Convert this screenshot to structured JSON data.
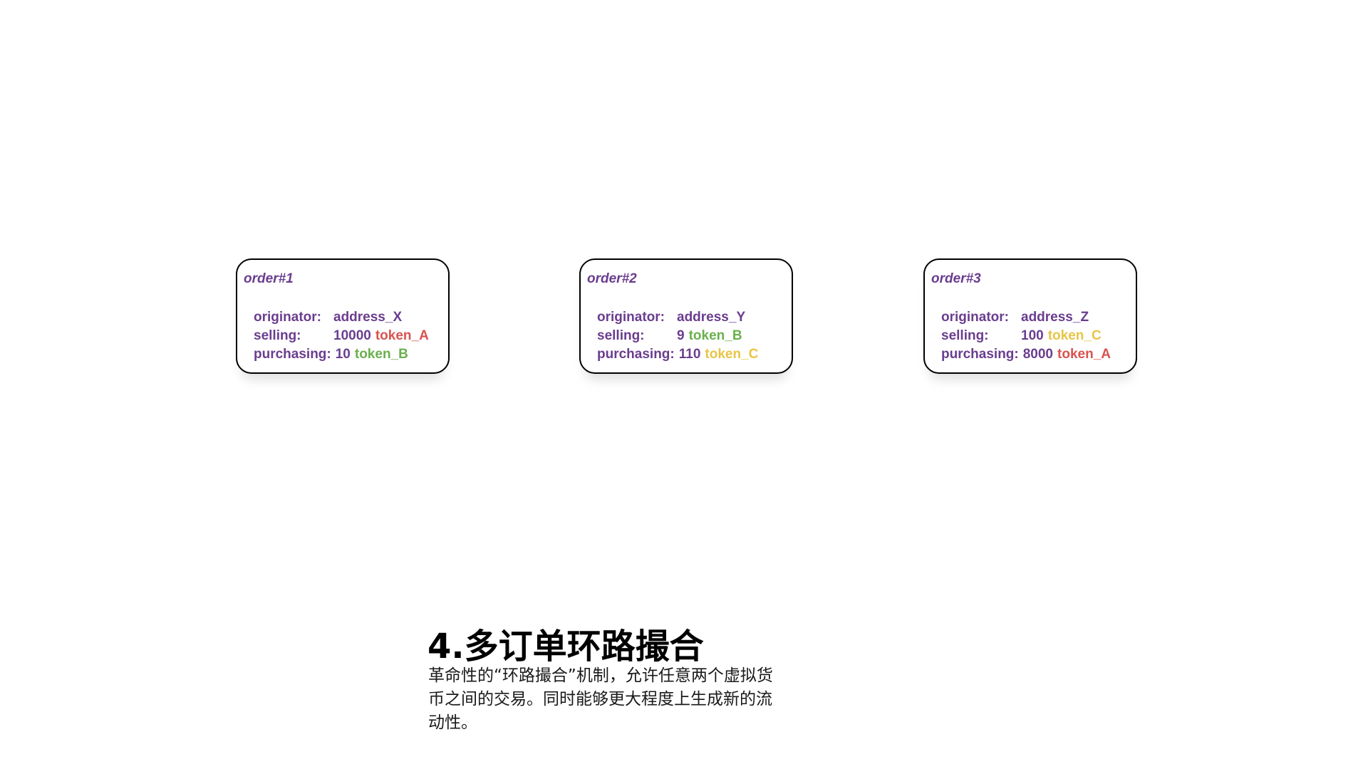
{
  "colors": {
    "text_purple": "#6a3d8f",
    "token_A": "#d9534f",
    "token_B": "#6ab04c",
    "token_C": "#e8c547",
    "card_border": "#000000"
  },
  "orders": [
    {
      "title": "order#1",
      "originator_label": "originator:",
      "originator_value": "address_X",
      "selling_label": "selling:",
      "selling_amount": "10000",
      "selling_token": "token_A",
      "purchasing_label": "purchasing:",
      "purchasing_amount": "10",
      "purchasing_token": "token_B"
    },
    {
      "title": "order#2",
      "originator_label": "originator:",
      "originator_value": "address_Y",
      "selling_label": "selling:",
      "selling_amount": "9",
      "selling_token": "token_B",
      "purchasing_label": "purchasing:",
      "purchasing_amount": "110",
      "purchasing_token": "token_C"
    },
    {
      "title": "order#3",
      "originator_label": "originator:",
      "originator_value": "address_Z",
      "selling_label": "selling:",
      "selling_amount": "100",
      "selling_token": "token_C",
      "purchasing_label": "purchasing:",
      "purchasing_amount": "8000",
      "purchasing_token": "token_A"
    }
  ],
  "section": {
    "heading": "4.多订单环路撮合",
    "description": "革命性的“环路撮合”机制，允许任意两个虚拟货币之间的交易。同时能够更大程度上生成新的流动性。"
  }
}
